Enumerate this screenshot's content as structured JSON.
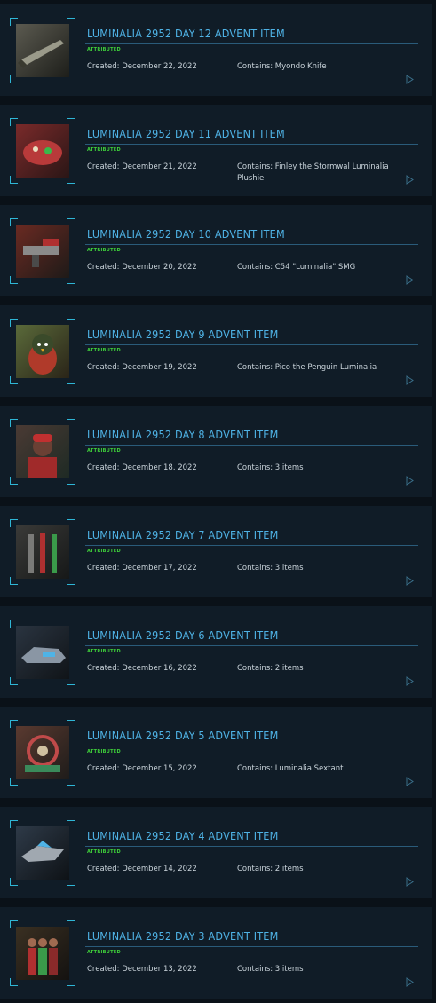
{
  "accent_color": "#4fb3e6",
  "status_color": "#3fd23a",
  "items": [
    {
      "title": "LUMINALIA 2952 DAY 12 ADVENT ITEM",
      "status": "ATTRIBUTED",
      "created": "Created: December 22, 2022",
      "contains": "Contains: Myondo Knife",
      "thumb_icon": "knife-icon",
      "c1": "#5b5a50",
      "c2": "#1d1e1a"
    },
    {
      "title": "LUMINALIA 2952 DAY 11 ADVENT ITEM",
      "status": "ATTRIBUTED",
      "created": "Created: December 21, 2022",
      "contains": "Contains: Finley the Stormwal Luminalia Plushie",
      "thumb_icon": "plushie-icon",
      "c1": "#7a2a2a",
      "c2": "#2a1616"
    },
    {
      "title": "LUMINALIA 2952 DAY 10 ADVENT ITEM",
      "status": "ATTRIBUTED",
      "created": "Created: December 20, 2022",
      "contains": "Contains: C54 \"Luminalia\" SMG",
      "thumb_icon": "smg-icon",
      "c1": "#6a2a22",
      "c2": "#1e1a18"
    },
    {
      "title": "LUMINALIA 2952 DAY 9 ADVENT ITEM",
      "status": "ATTRIBUTED",
      "created": "Created: December 19, 2022",
      "contains": "Contains: Pico the Penguin Luminalia",
      "thumb_icon": "penguin-icon",
      "c1": "#5a6a3a",
      "c2": "#2a2418"
    },
    {
      "title": "LUMINALIA 2952 DAY 8 ADVENT ITEM",
      "status": "ATTRIBUTED",
      "created": "Created: December 18, 2022",
      "contains": "Contains: 3 items",
      "thumb_icon": "character-icon",
      "c1": "#4a3a34",
      "c2": "#1e2a24"
    },
    {
      "title": "LUMINALIA 2952 DAY 7 ADVENT ITEM",
      "status": "ATTRIBUTED",
      "created": "Created: December 17, 2022",
      "contains": "Contains: 3 items",
      "thumb_icon": "weapon-rack-icon",
      "c1": "#3a3a38",
      "c2": "#161818"
    },
    {
      "title": "LUMINALIA 2952 DAY 6 ADVENT ITEM",
      "status": "ATTRIBUTED",
      "created": "Created: December 16, 2022",
      "contains": "Contains: 2 items",
      "thumb_icon": "vehicle-icon",
      "c1": "#2a3440",
      "c2": "#101418"
    },
    {
      "title": "LUMINALIA 2952 DAY 5 ADVENT ITEM",
      "status": "ATTRIBUTED",
      "created": "Created: December 15, 2022",
      "contains": "Contains: Luminalia Sextant",
      "thumb_icon": "sextant-icon",
      "c1": "#5a3a30",
      "c2": "#1e1c1a"
    },
    {
      "title": "LUMINALIA 2952 DAY 4 ADVENT ITEM",
      "status": "ATTRIBUTED",
      "created": "Created: December 14, 2022",
      "contains": "Contains: 2 items",
      "thumb_icon": "ship-icon",
      "c1": "#2e3a48",
      "c2": "#0e1216"
    },
    {
      "title": "LUMINALIA 2952 DAY 3 ADVENT ITEM",
      "status": "ATTRIBUTED",
      "created": "Created: December 13, 2022",
      "contains": "Contains: 3 items",
      "thumb_icon": "armor-icon",
      "c1": "#3a3022",
      "c2": "#141210"
    }
  ]
}
